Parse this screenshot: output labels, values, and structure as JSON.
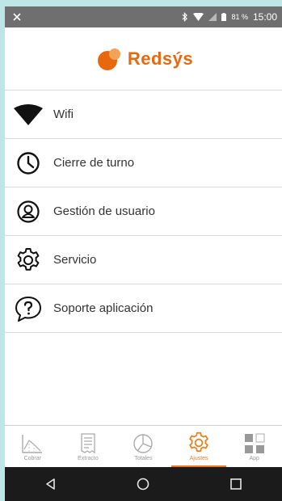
{
  "status_bar": {
    "battery_percent": "81 %",
    "time": "15:00"
  },
  "header": {
    "logo_text": "Redsýs",
    "logo_color": "#e8690d"
  },
  "menu": [
    {
      "label": "Wifi",
      "icon": "wifi-icon"
    },
    {
      "label": "Cierre de turno",
      "icon": "clock-icon"
    },
    {
      "label": "Gestión de usuario",
      "icon": "user-icon"
    },
    {
      "label": "Servicio",
      "icon": "gear-icon"
    },
    {
      "label": "Soporte aplicación",
      "icon": "help-icon"
    }
  ],
  "tabbar": {
    "tabs": [
      {
        "label": "Cobrar",
        "icon": "chart-icon"
      },
      {
        "label": "Extracto",
        "icon": "receipt-icon"
      },
      {
        "label": "Totales",
        "icon": "pie-icon"
      },
      {
        "label": "Ajustes",
        "icon": "gear-icon",
        "active": true
      },
      {
        "label": "App",
        "icon": "apps-icon"
      }
    ],
    "accent_color": "#f07d1b"
  },
  "navbar": {
    "buttons": [
      "back",
      "home",
      "recents"
    ]
  }
}
